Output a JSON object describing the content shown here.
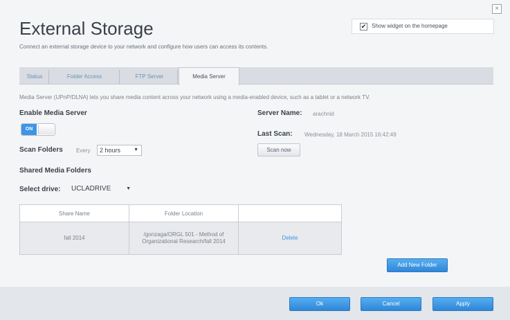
{
  "window": {
    "close_symbol": "×"
  },
  "header": {
    "title": "External Storage",
    "subtitle": "Connect an external storage device to your network and configure how users can access its contents.",
    "widget_checked": true,
    "widget_label": "Show widget on the homepage"
  },
  "tabs": [
    {
      "label": "Status",
      "active": false
    },
    {
      "label": "Folder Access",
      "active": false
    },
    {
      "label": "FTP Server",
      "active": false
    },
    {
      "label": "Media Server",
      "active": true
    }
  ],
  "media": {
    "description": "Media Server (UPnP/DLNA) lets you share media content across your network using a media-enabled device, such as a tablet or a network TV.",
    "enable_label": "Enable Media Server",
    "toggle_state": "ON",
    "scan_folders_label": "Scan Folders",
    "scan_every_label": "Every",
    "scan_interval": "2 hours",
    "server_name_label": "Server Name:",
    "server_name": "arachnid",
    "last_scan_label": "Last Scan:",
    "last_scan_value": "Wednesday, 18 March 2015 16:42:49",
    "scan_now_label": "Scan now",
    "shared_heading": "Shared Media Folders",
    "select_drive_label": "Select drive:",
    "selected_drive": "UCLADRIVE"
  },
  "table": {
    "headers": [
      "Share Name",
      "Folder Location",
      ""
    ],
    "rows": [
      {
        "share_name": "fall 2014",
        "folder_location": "/gonzaga/ORGL 501 - Method of Organizational Research/fall 2014",
        "action": "Delete"
      }
    ]
  },
  "buttons": {
    "add_folder": "Add New Folder",
    "ok": "Ok",
    "cancel": "Cancel",
    "apply": "Apply"
  },
  "colors": {
    "accent": "#3d95e6",
    "tab_link": "#6e8fb3",
    "background": "#f4f5f7"
  }
}
